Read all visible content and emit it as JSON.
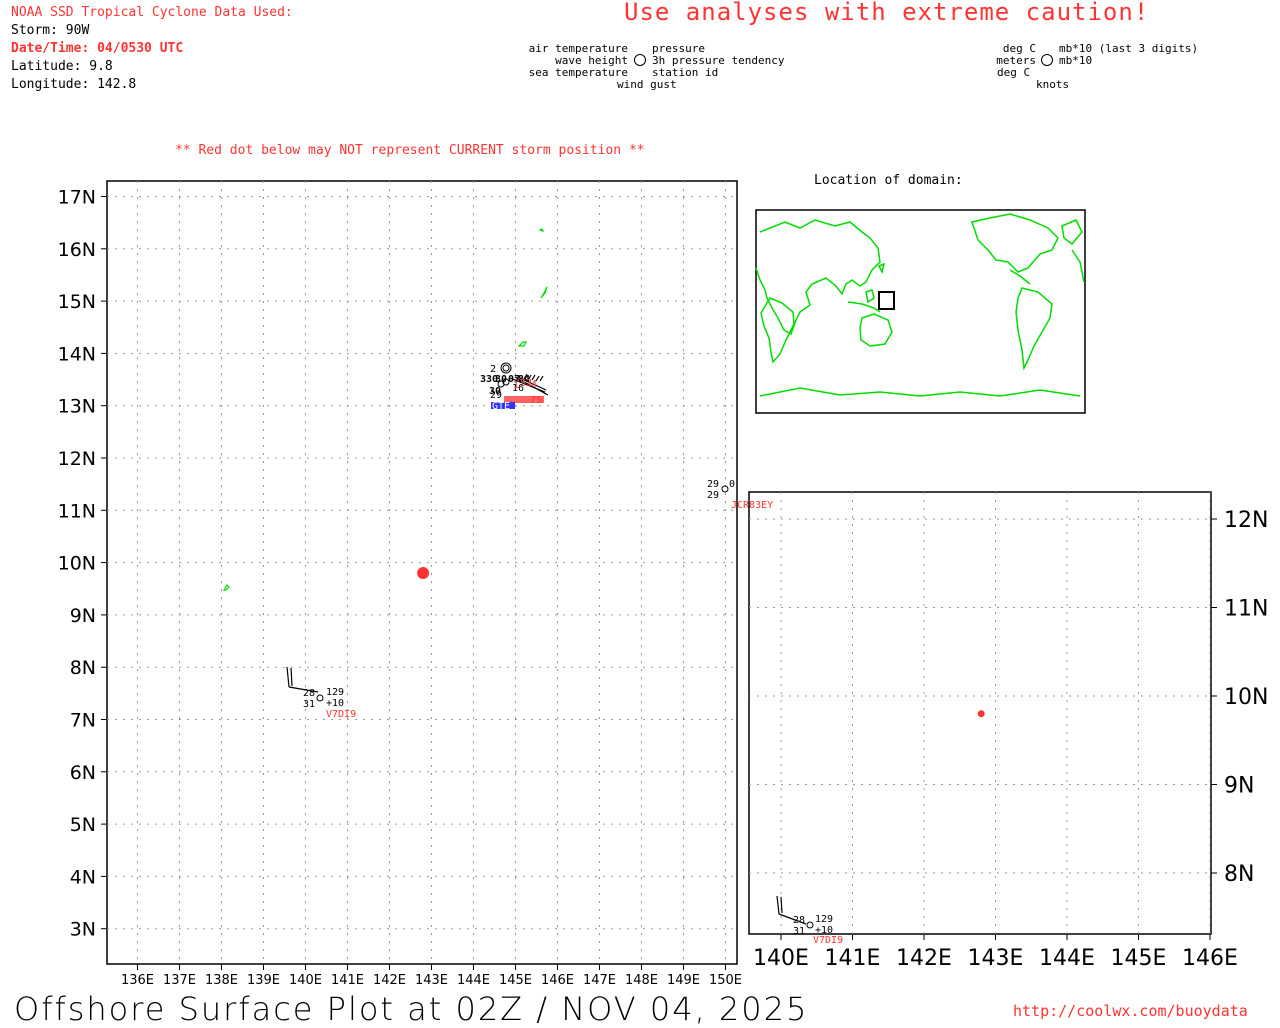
{
  "header": {
    "source_title": "NOAA SSD Tropical Cyclone Data Used:",
    "storm": "Storm: 90W",
    "datetime": "Date/Time: 04/0530 UTC",
    "latitude": "Latitude: 9.8",
    "longitude": "Longitude: 142.8",
    "caution": "Use analyses with extreme caution!",
    "red_dot_note": "** Red dot below may NOT represent CURRENT storm position **"
  },
  "station_legend": {
    "air_temperature": "air temperature",
    "pressure": "pressure",
    "wave_height": "wave height",
    "pressure_tendency": "3h pressure tendency",
    "sea_temperature": "sea temperature",
    "station_id": "station id",
    "wind_gust": "wind gust"
  },
  "units_legend": {
    "deg_c_top": "deg C",
    "pressure_unit": "mb*10 (last 3 digits)",
    "meters": "meters",
    "tendency_unit": "mb*10",
    "deg_c_bottom": "deg C",
    "knots": "knots"
  },
  "world_map": {
    "title": "Location of domain:"
  },
  "main_map": {
    "lat_labels": [
      "17N",
      "16N",
      "15N",
      "14N",
      "13N",
      "12N",
      "11N",
      "10N",
      "9N",
      "8N",
      "7N",
      "6N",
      "5N",
      "4N",
      "3N"
    ],
    "lat_values": [
      17,
      16,
      15,
      14,
      13,
      12,
      11,
      10,
      9,
      8,
      7,
      6,
      5,
      4,
      3
    ],
    "lon_labels": [
      "136E",
      "137E",
      "138E",
      "139E",
      "140E",
      "141E",
      "142E",
      "143E",
      "144E",
      "145E",
      "146E",
      "147E",
      "148E",
      "149E",
      "150E"
    ],
    "lon_values": [
      136,
      137,
      138,
      139,
      140,
      141,
      142,
      143,
      144,
      145,
      146,
      147,
      148,
      149,
      150
    ]
  },
  "inset_map": {
    "lat_labels": [
      "12N",
      "11N",
      "10N",
      "9N",
      "8N"
    ],
    "lat_values": [
      12,
      11,
      10,
      9,
      8
    ],
    "lon_labels": [
      "140E",
      "141E",
      "142E",
      "143E",
      "144E",
      "145E",
      "146E"
    ],
    "lon_values": [
      140,
      141,
      142,
      143,
      144,
      145,
      146
    ]
  },
  "storm_position": {
    "lat": 9.8,
    "lon": 142.8,
    "color": "#ff3333"
  },
  "stations": {
    "v7di9": {
      "id": "V7DI9",
      "air_temp": "28",
      "sea_temp": "31",
      "pressure": "129",
      "tendency": "+10"
    },
    "jcr83ey": {
      "id": "JCR83EY",
      "air_temp": "29",
      "sea_temp": "29",
      "pressure": "0"
    },
    "guam_cluster": {
      "wave": "2",
      "air_temp": "30",
      "sea_temp": "29",
      "tendency": "16"
    }
  },
  "colors": {
    "coastline": "#00dd00",
    "station_id": "#ff3333",
    "buoy_id": "#3333ff",
    "text_red": "#ff3333",
    "grid": "#999999"
  },
  "footer": {
    "title": "Offshore Surface Plot at 02Z / NOV 04, 2025",
    "url": "http://coolwx.com/buoydata"
  }
}
